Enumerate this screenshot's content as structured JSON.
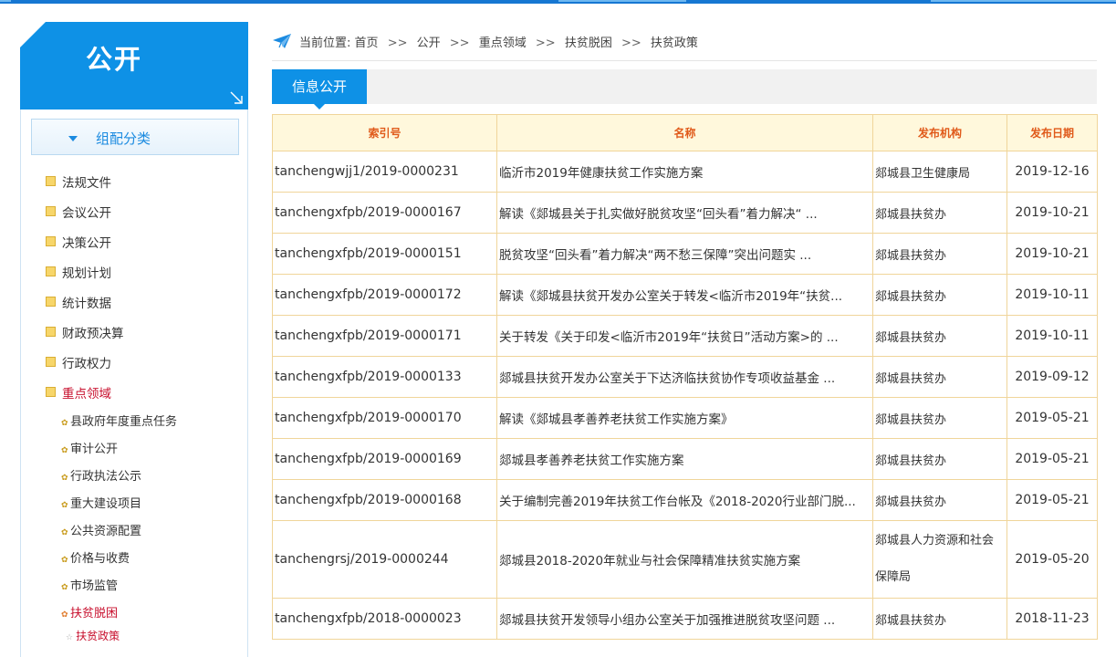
{
  "sidebar": {
    "title": "公开",
    "category_label": "组配分类",
    "items": [
      {
        "label": "法规文件"
      },
      {
        "label": "会议公开"
      },
      {
        "label": "决策公开"
      },
      {
        "label": "规划计划"
      },
      {
        "label": "统计数据"
      },
      {
        "label": "财政预决算"
      },
      {
        "label": "行政权力"
      },
      {
        "label": "重点领域",
        "active": true
      }
    ],
    "sub_items": [
      {
        "label": "县政府年度重点任务"
      },
      {
        "label": "审计公开"
      },
      {
        "label": "行政执法公示"
      },
      {
        "label": "重大建设项目"
      },
      {
        "label": "公共资源配置"
      },
      {
        "label": "价格与收费"
      },
      {
        "label": "市场监管"
      },
      {
        "label": "扶贫脱困",
        "active": true
      }
    ],
    "sub_sub_items": [
      {
        "label": "扶贫政策",
        "active": true
      }
    ]
  },
  "breadcrumb": {
    "prefix": "当前位置:",
    "separator": ">>",
    "items": [
      "首页",
      "公开",
      "重点领域",
      "扶贫脱困",
      "扶贫政策"
    ]
  },
  "tab": {
    "label": "信息公开"
  },
  "table": {
    "headers": [
      "索引号",
      "名称",
      "发布机构",
      "发布日期"
    ],
    "rows": [
      {
        "index": "tanchengwjj1/2019-0000231",
        "name": "临沂市2019年健康扶贫工作实施方案",
        "org": "郯城县卫生健康局",
        "date": "2019-12-16"
      },
      {
        "index": "tanchengxfpb/2019-0000167",
        "name": "解读《郯城县关于扎实做好脱贫攻坚“回头看”着力解决“ ...",
        "org": "郯城县扶贫办",
        "date": "2019-10-21"
      },
      {
        "index": "tanchengxfpb/2019-0000151",
        "name": "脱贫攻坚“回头看”着力解决“两不愁三保障”突出问题实 ...",
        "org": "郯城县扶贫办",
        "date": "2019-10-21"
      },
      {
        "index": "tanchengxfpb/2019-0000172",
        "name": "解读《郯城县扶贫开发办公室关于转发<临沂市2019年“扶贫...",
        "org": "郯城县扶贫办",
        "date": "2019-10-11"
      },
      {
        "index": "tanchengxfpb/2019-0000171",
        "name": "关于转发《关于印发<临沂市2019年“扶贫日”活动方案>的 ...",
        "org": "郯城县扶贫办",
        "date": "2019-10-11"
      },
      {
        "index": "tanchengxfpb/2019-0000133",
        "name": "郯城县扶贫开发办公室关于下达济临扶贫协作专项收益基金 ...",
        "org": "郯城县扶贫办",
        "date": "2019-09-12"
      },
      {
        "index": "tanchengxfpb/2019-0000170",
        "name": "解读《郯城县孝善养老扶贫工作实施方案》",
        "org": "郯城县扶贫办",
        "date": "2019-05-21"
      },
      {
        "index": "tanchengxfpb/2019-0000169",
        "name": "郯城县孝善养老扶贫工作实施方案",
        "org": "郯城县扶贫办",
        "date": "2019-05-21"
      },
      {
        "index": "tanchengxfpb/2019-0000168",
        "name": "关于编制完善2019年扶贫工作台帐及《2018-2020行业部门脱...",
        "org": "郯城县扶贫办",
        "date": "2019-05-21"
      },
      {
        "index": "tanchengrsj/2019-0000244",
        "name": "郯城县2018-2020年就业与社会保障精准扶贫实施方案",
        "org": "郯城县人力资源和社会保障局",
        "date": "2019-05-20",
        "tall": true
      },
      {
        "index": "tanchengxfpb/2018-0000023",
        "name": "郯城县扶贫开发领导小组办公室关于加强推进脱贫攻坚问题 ...",
        "org": "郯城县扶贫办",
        "date": "2018-11-23"
      }
    ]
  },
  "colors": {
    "brand_blue": "#0e91e6",
    "header_text": "#e05a1a",
    "active_red": "#c8102e",
    "table_border": "#f0d59a"
  }
}
